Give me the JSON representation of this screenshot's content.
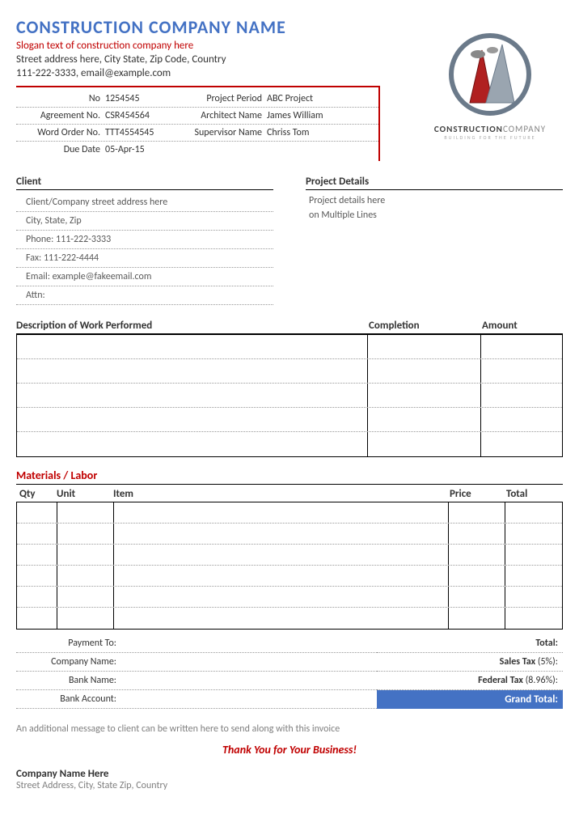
{
  "header": {
    "company_name": "CONSTRUCTION COMPANY NAME",
    "slogan": "Slogan text of construction company here",
    "address": "Street address here, City State, Zip Code, Country",
    "contact": "111-222-3333, email@example.com"
  },
  "logo": {
    "line1a": "CONSTRUCTION",
    "line1b": "COMPANY",
    "line2": "BUILDING FOR THE FUTURE"
  },
  "meta": {
    "no_label": "No",
    "no_val": "1254545",
    "period_label": "Project Period",
    "period_val": "ABC Project",
    "agree_label": "Agreement No.",
    "agree_val": "CSR454564",
    "arch_label": "Architect Name",
    "arch_val": "James William",
    "word_label": "Word Order No.",
    "word_val": "TTT4554545",
    "sup_label": "Supervisor Name",
    "sup_val": "Chriss Tom",
    "due_label": "Due Date",
    "due_val": "05-Apr-15"
  },
  "client": {
    "title": "Client",
    "rows": [
      "Client/Company street address here",
      "City, State, Zip",
      "Phone: 111-222-3333",
      "Fax: 111-222-4444",
      "Email: example@fakeemail.com",
      "Attn:"
    ]
  },
  "project": {
    "title": "Project Details",
    "line1": "Project details here",
    "line2": "on Multiple Lines"
  },
  "work": {
    "desc_h": "Description of Work Performed",
    "comp_h": "Completion",
    "amt_h": "Amount"
  },
  "materials": {
    "title": "Materials / Labor",
    "qty_h": "Qty",
    "unit_h": "Unit",
    "item_h": "Item",
    "price_h": "Price",
    "total_h": "Total"
  },
  "payment": {
    "to": "Payment To:",
    "company": "Company Name:",
    "bank": "Bank Name:",
    "account": "Bank Account:"
  },
  "totals": {
    "total": "Total:",
    "sales_b": "Sales Tax",
    "sales_r": " (5%):",
    "fed_b": "Federal Tax",
    "fed_r": " (8.96%):",
    "grand": "Grand Total:"
  },
  "footer": {
    "msg": "An additional message to client can be written here to send along with this invoice",
    "thanks": "Thank You for Your Business!",
    "name": "Company Name Here",
    "addr": "Street Address, City, State Zip, Country"
  }
}
